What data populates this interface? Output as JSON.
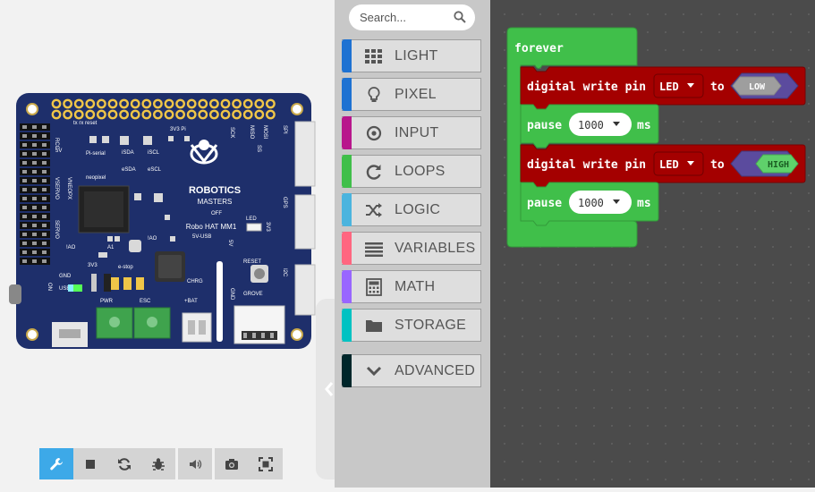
{
  "board": {
    "brand_line1": "ROBOTICS",
    "brand_line2": "MASTERS",
    "model": "Robo HAT MM1",
    "labels": {
      "rx_tx": "tx  rx  reset",
      "pi_serial": "Pi-serial",
      "neopixel": "neopixel",
      "rcc": "RCC",
      "fivev": "5V",
      "vservo": "VSERVO",
      "vneopx": "VNEOPX",
      "servo": "SERVO",
      "ao": "!AO",
      "a1": "A1",
      "ao2": "!AO",
      "threev3": "3V3",
      "threev3pi": "3V3 Pi",
      "e_stop": "e-stop",
      "gnd": "GND",
      "usb": "USB",
      "pwr": "PWR",
      "esc": "ESC",
      "bat": "+BAT",
      "chrg": "CHRG",
      "reset": "RESET",
      "grove": "GROVE",
      "led": "LED",
      "off": "OFF",
      "fivev_usb": "5V-USB",
      "sda": "SDA",
      "scl": "SCL",
      "esda": "eSDA",
      "escl": "eSCL",
      "isda": "iSDA",
      "iscl": "iSCL",
      "sck": "SCK",
      "spi": "SPI",
      "gps": "GPS",
      "i2c": "I2C",
      "gnd2": "GND",
      "miso": "MISO",
      "mosi": "MOSI",
      "ss": "SS",
      "plus": "+",
      "fivev2": "5V",
      "threev3b": "3V3",
      "on": "ON"
    }
  },
  "toolbar": {
    "buttons": [
      {
        "name": "wrench-icon",
        "active": true
      },
      {
        "name": "stop-icon",
        "active": false
      },
      {
        "name": "restart-icon",
        "active": false
      },
      {
        "name": "debug-icon",
        "active": false
      },
      {
        "name": "sound-icon",
        "active": false
      },
      {
        "name": "screenshot-icon",
        "active": false
      },
      {
        "name": "fullscreen-icon",
        "active": false
      }
    ]
  },
  "search": {
    "placeholder": "Search..."
  },
  "categories": [
    {
      "label": "LIGHT",
      "color": "#1e72d2",
      "icon": "grid-icon"
    },
    {
      "label": "PIXEL",
      "color": "#1e72d2",
      "icon": "lightbulb-icon"
    },
    {
      "label": "INPUT",
      "color": "#b8168c",
      "icon": "target-icon"
    },
    {
      "label": "LOOPS",
      "color": "#40bf4a",
      "icon": "refresh-icon"
    },
    {
      "label": "LOGIC",
      "color": "#4bb4de",
      "icon": "shuffle-icon"
    },
    {
      "label": "VARIABLES",
      "color": "#ff6680",
      "icon": "list-icon"
    },
    {
      "label": "MATH",
      "color": "#9966ff",
      "icon": "calculator-icon"
    },
    {
      "label": "STORAGE",
      "color": "#00c2c2",
      "icon": "folder-icon"
    },
    {
      "label": "ADVANCED",
      "color": "#00272b",
      "icon": "chevron-down-icon"
    }
  ],
  "program": {
    "forever_label": "forever",
    "write_label": "digital write pin",
    "pin1": "LED",
    "to1": "to",
    "value1": "LOW",
    "pause_label": "pause",
    "pause1": "1000",
    "ms1": "ms",
    "pin2": "LED",
    "to2": "to",
    "value2": "HIGH",
    "pause2": "1000",
    "ms2": "ms"
  },
  "colors": {
    "board": "#1e2f6b",
    "loops_block": "#40bf4a",
    "pins_block": "#a40000",
    "boolean_block": "#5b4b9e",
    "workspace": "#4b4b4b",
    "toolbar_active": "#3da9e8"
  }
}
